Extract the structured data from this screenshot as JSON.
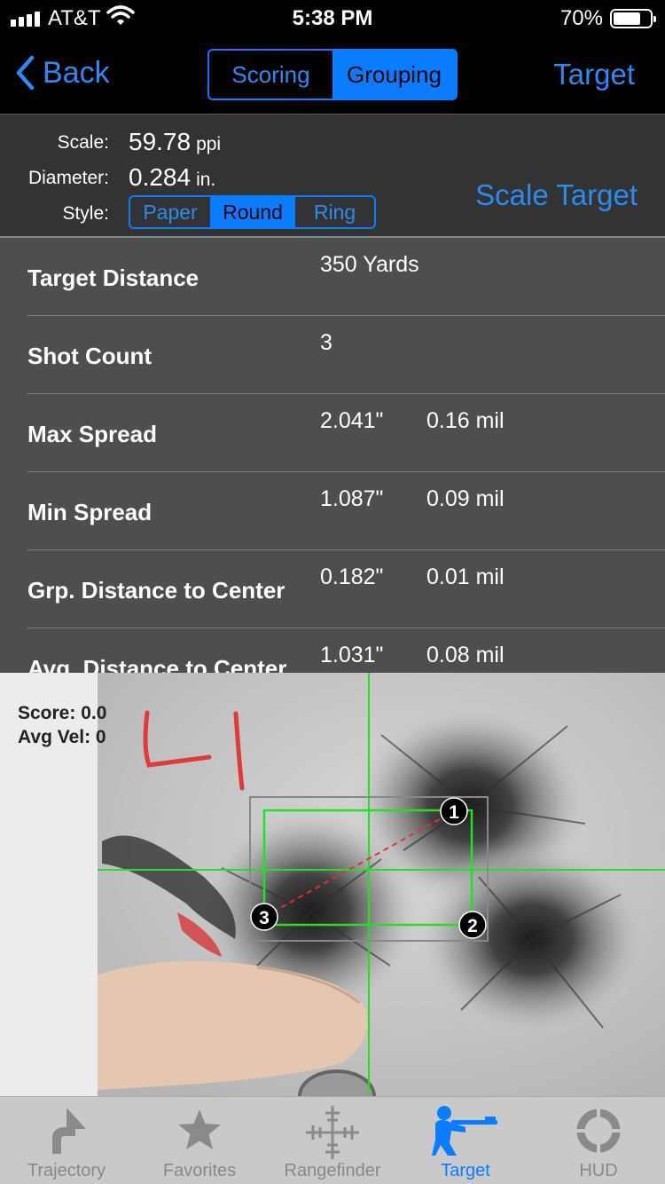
{
  "status": {
    "carrier": "AT&T",
    "time": "5:38 PM",
    "battery": "70%"
  },
  "nav": {
    "back_label": "Back",
    "segments": [
      "Scoring",
      "Grouping"
    ],
    "selected_segment": "Grouping",
    "right_label": "Target"
  },
  "scale": {
    "scale_label": "Scale:",
    "scale_value": "59.78",
    "scale_unit": "ppi",
    "diameter_label": "Diameter:",
    "diameter_value": "0.284",
    "diameter_unit": "in.",
    "style_label": "Style:",
    "style_options": [
      "Paper",
      "Round",
      "Ring"
    ],
    "style_selected": "Round",
    "scale_target_label": "Scale Target"
  },
  "stats": [
    {
      "name": "Target Distance",
      "v1": "350 Yards",
      "v2": ""
    },
    {
      "name": "Shot Count",
      "v1": "3",
      "v2": ""
    },
    {
      "name": "Max Spread",
      "v1": "2.041\"",
      "v2": "0.16 mil"
    },
    {
      "name": "Min Spread",
      "v1": "1.087\"",
      "v2": "0.09 mil"
    },
    {
      "name": "Grp. Distance to Center",
      "v1": "0.182\"",
      "v2": "0.01 mil"
    },
    {
      "name": "Avg. Distance to Center",
      "v1": "1.031\"",
      "v2": "0.08 mil"
    }
  ],
  "target": {
    "score_text": "Score: 0.0",
    "avg_vel_text": "Avg Vel: 0",
    "shot_labels": [
      "1",
      "2",
      "3"
    ],
    "crosshair_color": "#22e022",
    "spread_line_color": "#e03030"
  },
  "tabs": [
    {
      "label": "Trajectory",
      "icon": "trajectory-icon",
      "active": false
    },
    {
      "label": "Favorites",
      "icon": "star-icon",
      "active": false
    },
    {
      "label": "Rangefinder",
      "icon": "crosshair-icon",
      "active": false
    },
    {
      "label": "Target",
      "icon": "rifleman-icon",
      "active": true
    },
    {
      "label": "HUD",
      "icon": "hud-icon",
      "active": false
    }
  ],
  "accent_color": "#0a7cff"
}
